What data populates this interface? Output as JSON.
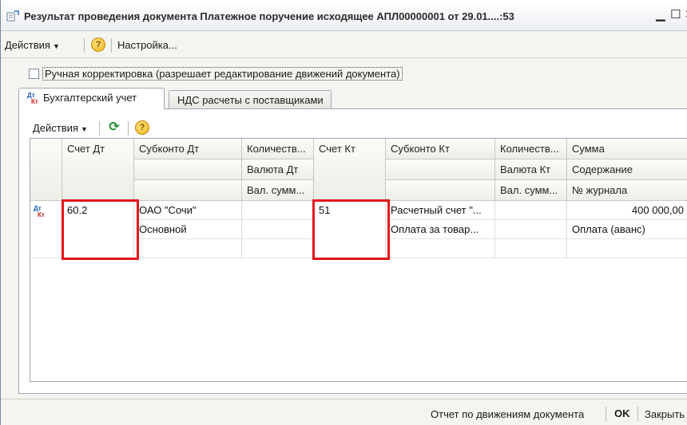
{
  "window": {
    "title": "Результат проведения документа Платежное поручение исходящее АПЛ00000001 от 29.01....:53"
  },
  "menubar": {
    "actions_label": "Действия",
    "help_label": "?",
    "settings_label": "Настройка..."
  },
  "manual_edit": {
    "checked": false,
    "label": "Ручная корректировка (разрешает редактирование движений документа)"
  },
  "tabs": [
    {
      "label": "Бухгалтерский учет",
      "active": true,
      "icon_top": "Дт",
      "icon_bottom": "Кт"
    },
    {
      "label": "НДС расчеты с поставщиками",
      "active": false
    }
  ],
  "toolbar": {
    "actions_label": "Действия",
    "refresh_icon": "refresh-icon",
    "help_label": "?"
  },
  "table": {
    "headers": {
      "row1": [
        "Счет Дт",
        "Субконто Дт",
        "Количеств...",
        "Счет Кт",
        "Субконто Кт",
        "Количеств...",
        "Сумма"
      ],
      "row2": [
        "Валюта Дт",
        "Валюта Кт",
        "Содержание"
      ],
      "row3": [
        "Вал. сумм...",
        "Вал. сумм...",
        "№ журнала"
      ]
    },
    "rows": [
      {
        "icon_top": "Дт",
        "icon_bottom": "Кт",
        "account_dt": "60.2",
        "subconto_dt": [
          "ОАО \"Сочи\"",
          "Основной",
          ""
        ],
        "account_kt": "51",
        "subconto_kt": [
          "Расчетный счет \"...",
          "Оплата за товар...",
          ""
        ],
        "amount": "400 000,00",
        "content": "Оплата (аванс)"
      }
    ]
  },
  "statusbar": {
    "report_label": "Отчет по движениям документа",
    "ok_label": "OK",
    "close_label": "Закрыть"
  },
  "colors": {
    "highlight": "#e3151b",
    "refresh": "#1f8f2a"
  }
}
